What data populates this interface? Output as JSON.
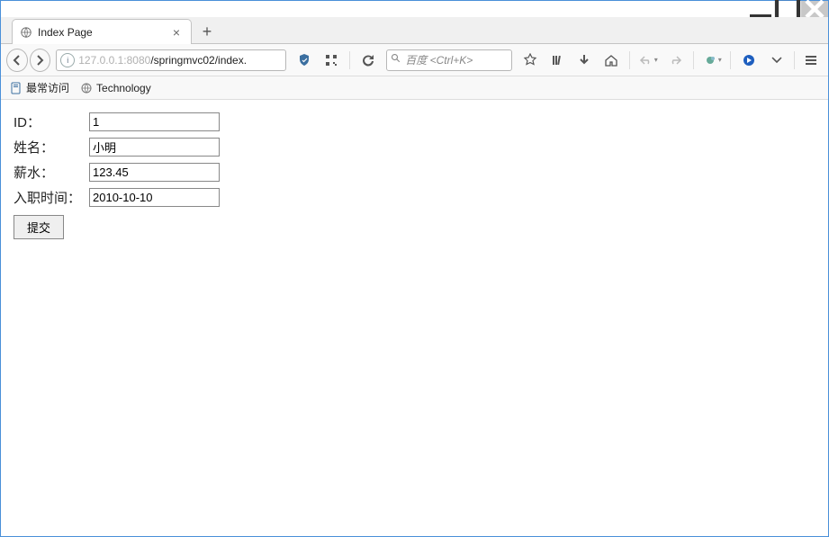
{
  "window": {
    "tab_title": "Index Page"
  },
  "nav": {
    "url_dim_prefix": "127.0.0.1",
    "url_port": ":8080",
    "url_path": "/springmvc02/index.",
    "search_placeholder": "百度 <Ctrl+K>"
  },
  "bookmarks": {
    "most_visited": "最常访问",
    "tech": "Technology"
  },
  "form": {
    "id_label": "ID：",
    "id_value": "1",
    "name_label": "姓名：",
    "name_value": "小明",
    "salary_label": "薪水：",
    "salary_value": "123.45",
    "hiredate_label": "入职时间：",
    "hiredate_value": "2010-10-10",
    "submit_label": "提交"
  }
}
